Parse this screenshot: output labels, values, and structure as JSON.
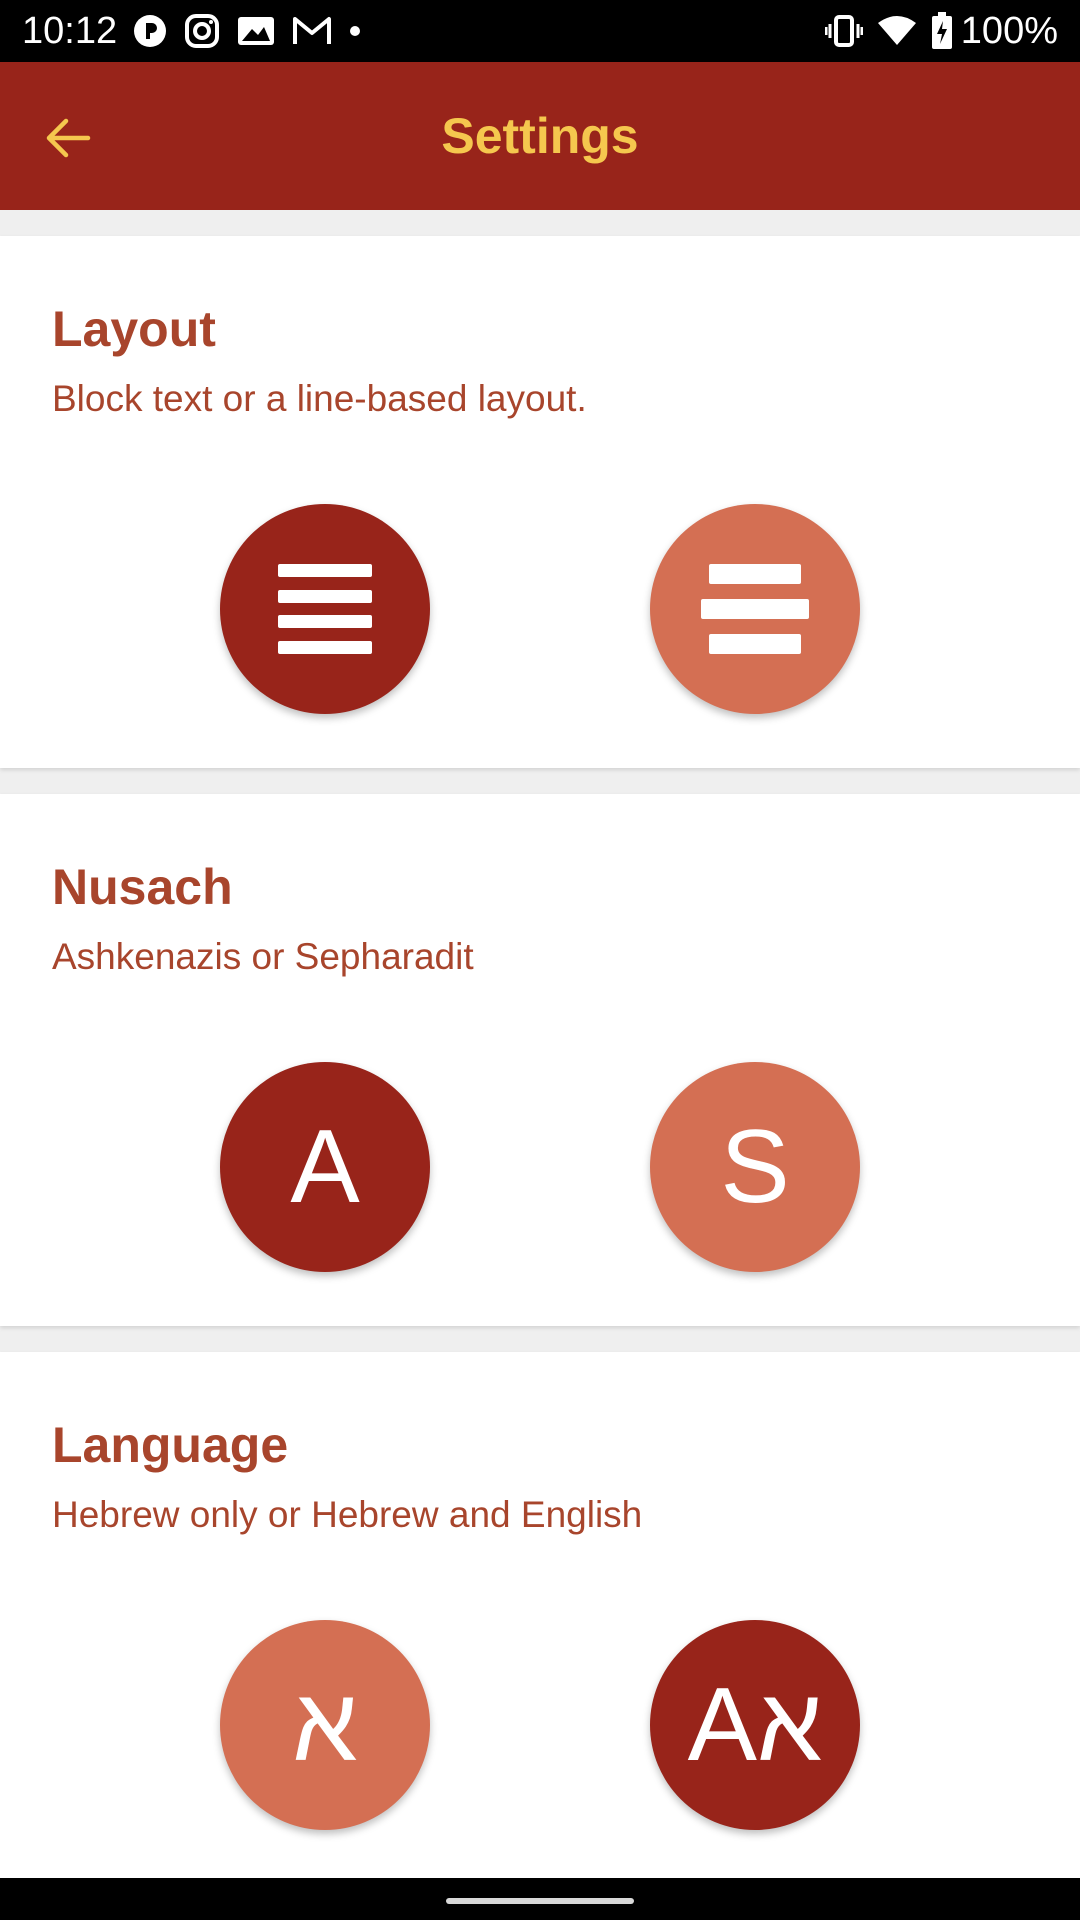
{
  "status_bar": {
    "time": "10:12",
    "left_icons": [
      "pinwheel-icon",
      "instagram-icon",
      "photo-icon",
      "gmail-icon",
      "notification-dot-icon"
    ],
    "right_icons": [
      "vibrate-icon",
      "wifi-icon",
      "battery-charging-icon"
    ],
    "battery": "100%"
  },
  "app_bar": {
    "title": "Settings",
    "back_icon": "arrow-back-icon",
    "background_color": "#98241a",
    "title_color": "#f5c74e"
  },
  "colors": {
    "selected": "#98241a",
    "unselected": "#d46f53",
    "text": "#a8452c",
    "page_background": "#efefef"
  },
  "sections": [
    {
      "title": "Layout",
      "description": "Block text or a line-based layout.",
      "options": [
        {
          "icon": "block-text-icon",
          "selected": true
        },
        {
          "icon": "centered-lines-icon",
          "selected": false
        }
      ]
    },
    {
      "title": "Nusach",
      "description": "Ashkenazis or Sepharadit",
      "options": [
        {
          "label": "A",
          "selected": true
        },
        {
          "label": "S",
          "selected": false
        }
      ]
    },
    {
      "title": "Language",
      "description": "Hebrew only or Hebrew and English",
      "options": [
        {
          "label": "א",
          "selected": false
        },
        {
          "label": "Aא",
          "selected": true
        }
      ]
    }
  ]
}
